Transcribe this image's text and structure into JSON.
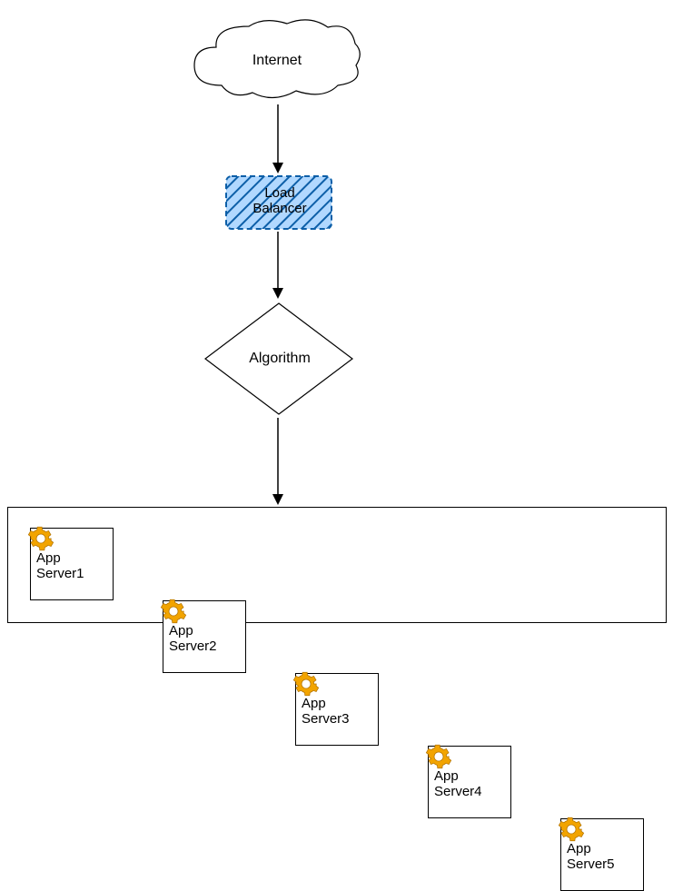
{
  "nodes": {
    "internet": "Internet",
    "loadBalancer": "Load\nBalancer",
    "algorithm": "Algorithm"
  },
  "servers": [
    {
      "label": "App",
      "hostA": "Server1",
      "hostB1": "App",
      "hostB2": "Server1"
    },
    {
      "label": "App",
      "host": "Server2"
    },
    {
      "label": "App",
      "host": "Server3"
    },
    {
      "label": "App",
      "host": "Server4"
    },
    {
      "label": "App",
      "host": "Server5"
    }
  ]
}
